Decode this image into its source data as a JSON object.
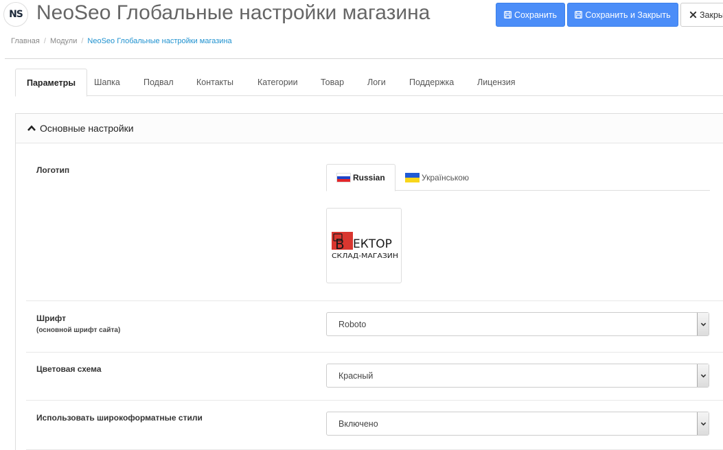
{
  "header": {
    "logo_text": "NS",
    "title": "NeoSeo Глобальные настройки магазина",
    "buttons": {
      "save": "Сохранить",
      "save_close": "Сохранить и Закрыть",
      "close": "Закры"
    }
  },
  "breadcrumb": [
    "Главная",
    "Модули",
    "NeoSeo Глобальные настройки магазина"
  ],
  "tabs": [
    "Параметры",
    "Шапка",
    "Подвал",
    "Контакты",
    "Категории",
    "Товар",
    "Логи",
    "Поддержка",
    "Лицензия"
  ],
  "active_tab": "Параметры",
  "panel": {
    "title": "Основные настройки"
  },
  "settings": {
    "logo": {
      "label": "Логотип",
      "languages": [
        "Russian",
        "Українською"
      ],
      "active_language": "Russian",
      "image_text": {
        "brand": "ЕКТОР",
        "brand_letter": "В",
        "subtitle": "СКЛАД-МАГАЗИН"
      }
    },
    "font": {
      "label": "Шрифт",
      "help": "(основной шрифт сайта)",
      "value": "Roboto"
    },
    "color_scheme": {
      "label": "Цветовая схема",
      "value": "Красный"
    },
    "wide_styles": {
      "label": "Использовать широкоформатные стили",
      "value": "Включено"
    }
  },
  "colors": {
    "primary": "#4b8df8",
    "link": "#1e91cf",
    "logo_red": "#d9362f"
  }
}
